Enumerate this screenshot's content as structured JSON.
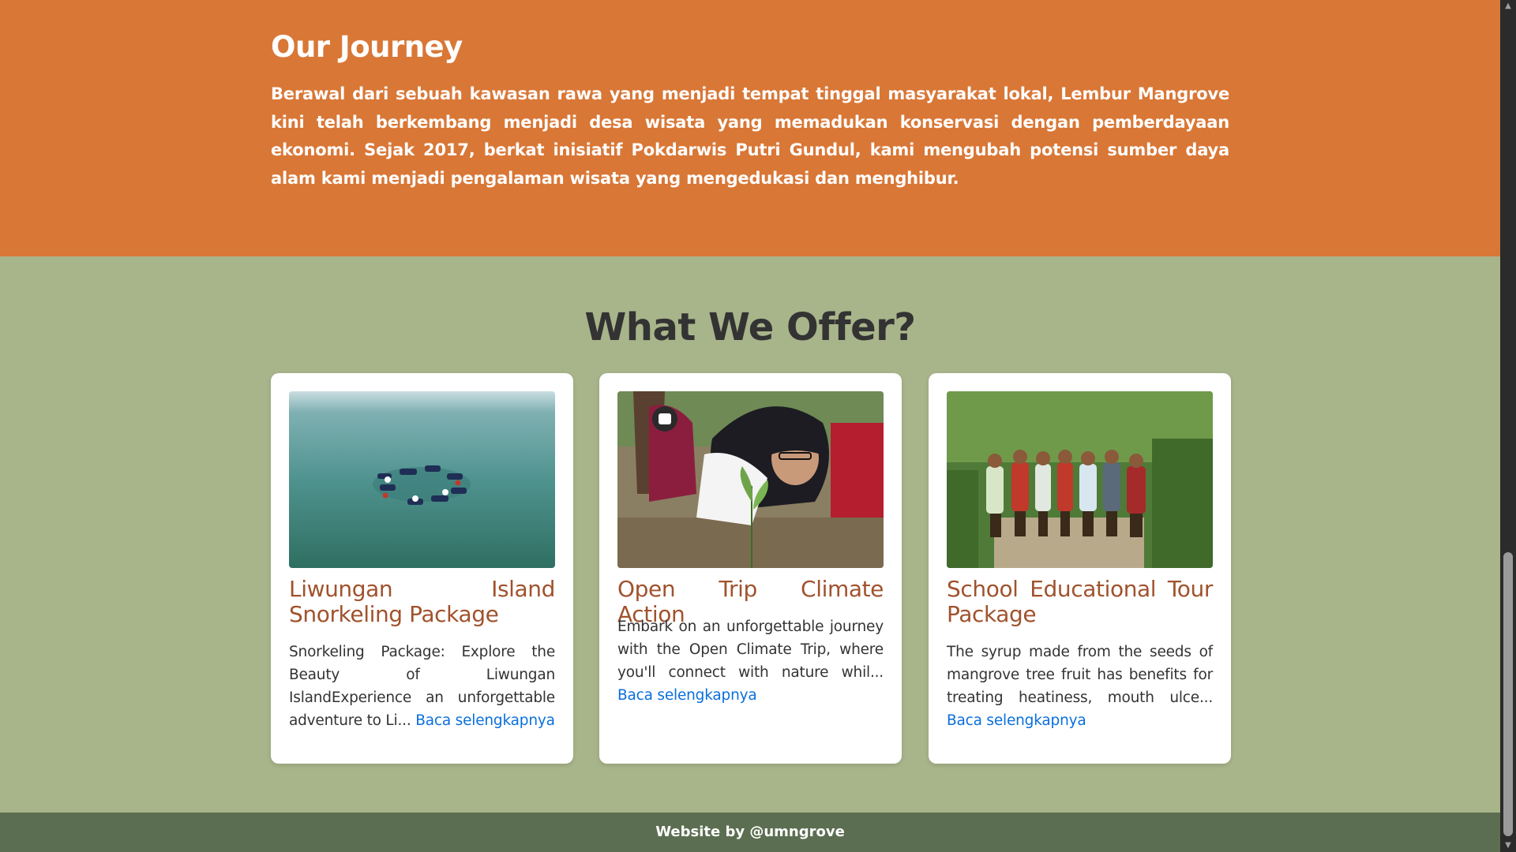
{
  "journey": {
    "title": "Our Journey",
    "text": "Berawal dari sebuah kawasan rawa yang menjadi tempat tinggal masyarakat lokal, Lembur Mangrove kini telah berkembang menjadi desa wisata yang memadukan konservasi dengan pemberdayaan ekonomi. Sejak 2017, berkat inisiatif Pokdarwis Putri Gundul, kami mengubah potensi sumber daya alam kami menjadi pengalaman wisata yang mengedukasi dan menghibur."
  },
  "offer": {
    "title": "What We Offer?",
    "cards": [
      {
        "title": "Liwungan Island Snorkeling Package",
        "desc": "Snorkeling Package: Explore the Beauty of Liwungan IslandExperience an unforgettable adventure to Li...",
        "link": "Baca selengkapnya",
        "image_icon": "snorkeling-photo"
      },
      {
        "title": "Open Trip Climate Action",
        "desc": "Embark on an unforgettable journey with the Open Climate Trip, where you'll connect with nature whil...",
        "link": "Baca selengkapnya",
        "image_icon": "mangrove-planting-photo"
      },
      {
        "title": "School Educational Tour Package",
        "desc": "The syrup made from the seeds of mangrove tree fruit has benefits for treating heatiness, mouth ulce...",
        "link": "Baca selengkapnya",
        "image_icon": "group-photo"
      }
    ]
  },
  "footer": {
    "text": "Website by @umngrove"
  },
  "colors": {
    "journey_bg": "#d97736",
    "offer_bg": "#a8b48a",
    "footer_bg": "#5c6e51",
    "card_title": "#a0522d",
    "link": "#0a6fdc"
  }
}
